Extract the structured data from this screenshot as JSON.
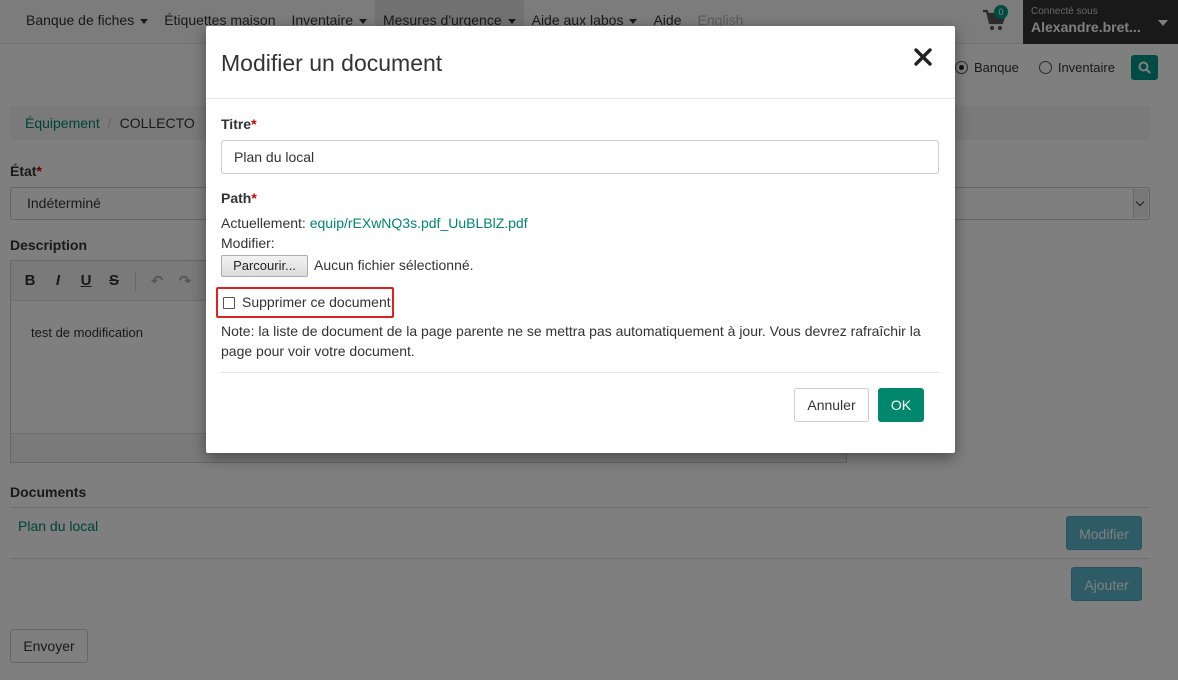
{
  "navbar": {
    "items": [
      {
        "label": "Banque de fiches",
        "dropdown": true
      },
      {
        "label": "Étiquettes maison",
        "dropdown": false
      },
      {
        "label": "Inventaire",
        "dropdown": true
      },
      {
        "label": "Mesures d'urgence",
        "dropdown": true
      },
      {
        "label": "Aide aux labos",
        "dropdown": true
      },
      {
        "label": "Aide",
        "dropdown": false
      },
      {
        "label": "English",
        "dropdown": false
      }
    ],
    "cart_count": "0",
    "user_small": "Connecté sous",
    "user_name": "Alexandre.bret..."
  },
  "search_scope": {
    "option1": "Banque",
    "option2": "Inventaire",
    "selected": "Banque"
  },
  "breadcrumb": {
    "parent": "Équipement",
    "current": "COLLECTO"
  },
  "form": {
    "etat_label": "État",
    "etat_value": "Indéterminé",
    "description_label": "Description",
    "description_text": "test de modification",
    "toolbar": {
      "bold": "B",
      "italic": "I",
      "underline": "U",
      "strike": "S",
      "undo": "↶",
      "redo": "↷"
    },
    "documents_label": "Documents",
    "document_link": "Plan du local",
    "modify_button": "Modifier",
    "add_button": "Ajouter",
    "submit_button": "Envoyer"
  },
  "modal": {
    "title": "Modifier un document",
    "title_label": "Titre",
    "title_value": "Plan du local",
    "path_label": "Path",
    "current_label": "Actuellement:",
    "current_file": "equip/rEXwNQ3s.pdf_UuBLBlZ.pdf",
    "modify_label": "Modifier:",
    "browse_button": "Parcourir...",
    "no_file": "Aucun fichier sélectionné.",
    "delete_label": "Supprimer ce document",
    "note": "Note: la liste de document de la page parente ne se mettra pas automatiquement à jour. Vous devrez rafraîchir la page pour voir votre document.",
    "cancel_button": "Annuler",
    "ok_button": "OK"
  },
  "colors": {
    "accent": "#00876c",
    "info": "#5bb8ce",
    "required": "#cc0000",
    "highlight": "#dd2222"
  }
}
